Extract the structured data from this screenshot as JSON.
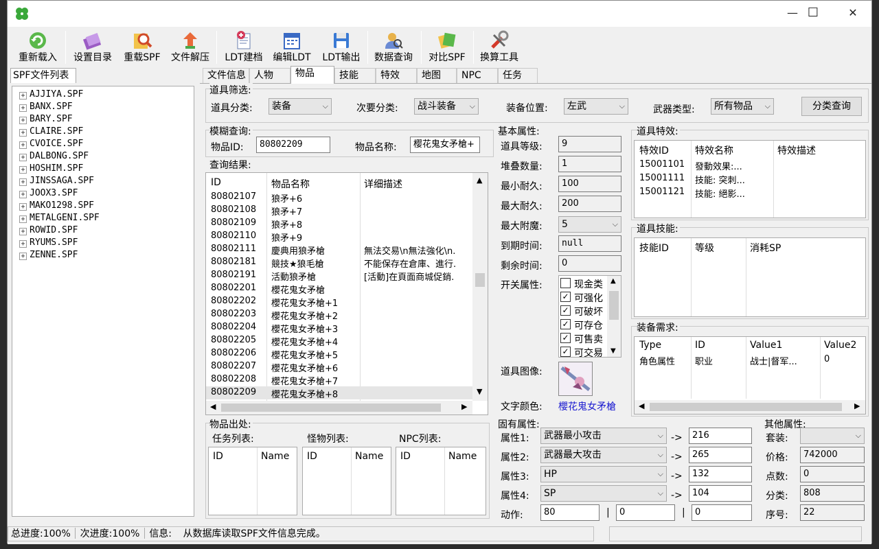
{
  "toolbar": {
    "items": [
      {
        "label": "重新载入",
        "icon": "reload-icon"
      },
      {
        "label": "设置目录",
        "icon": "folder-settings-icon"
      },
      {
        "label": "重载SPF",
        "icon": "search-reload-icon"
      },
      {
        "label": "文件解压",
        "icon": "extract-icon"
      },
      {
        "label": "LDT建档",
        "icon": "add-document-icon"
      },
      {
        "label": "编辑LDT",
        "icon": "calendar-edit-icon"
      },
      {
        "label": "LDT输出",
        "icon": "save-disk-icon"
      },
      {
        "label": "数据查询",
        "icon": "user-search-icon"
      },
      {
        "label": "对比SPF",
        "icon": "compare-icon"
      },
      {
        "label": "换算工具",
        "icon": "tools-icon"
      }
    ]
  },
  "left": {
    "title": "SPF文件列表",
    "files": [
      "AJJIYA.SPF",
      "BANX.SPF",
      "BARY.SPF",
      "CLAIRE.SPF",
      "CVOICE.SPF",
      "DALBONG.SPF",
      "HOSHIM.SPF",
      "JINSSAGA.SPF",
      "JOOX3.SPF",
      "MAKO1298.SPF",
      "METALGENI.SPF",
      "ROWID.SPF",
      "RYUMS.SPF",
      "ZENNE.SPF"
    ]
  },
  "tabs": [
    "文件信息",
    "人物",
    "物品",
    "技能",
    "特效",
    "地图",
    "NPC",
    "任务"
  ],
  "filter": {
    "title": "道具筛选:",
    "cat_label": "道具分类:",
    "cat_value": "装备",
    "sub_label": "次要分类:",
    "sub_value": "战斗装备",
    "pos_label": "装备位置:",
    "pos_value": "左武",
    "weapon_label": "武器类型:",
    "weapon_value": "所有物品",
    "query_button": "分类查询"
  },
  "fuzzy": {
    "title": "模糊查询:",
    "id_label": "物品ID:",
    "id_value": "80802209",
    "name_label": "物品名称:",
    "name_value": "樱花鬼女矛槍+"
  },
  "results": {
    "title": "查询结果:",
    "headers": [
      "ID",
      "物品名称",
      "详细描述"
    ],
    "rows": [
      [
        "80802107",
        "狼矛+6",
        ""
      ],
      [
        "80802108",
        "狼矛+7",
        ""
      ],
      [
        "80802109",
        "狼矛+8",
        ""
      ],
      [
        "80802110",
        "狼矛+9",
        ""
      ],
      [
        "80802111",
        "慶典用狼矛槍",
        "無法交易\\n無法強化\\n."
      ],
      [
        "80802181",
        "競技★狼毛槍",
        "不能保存在倉庫、進行."
      ],
      [
        "80802191",
        "活動狼矛槍",
        "[活動]在頁面商城促銷."
      ],
      [
        "80802201",
        "櫻花鬼女矛槍",
        ""
      ],
      [
        "80802202",
        "櫻花鬼女矛槍+1",
        ""
      ],
      [
        "80802203",
        "櫻花鬼女矛槍+2",
        ""
      ],
      [
        "80802204",
        "櫻花鬼女矛槍+3",
        ""
      ],
      [
        "80802205",
        "櫻花鬼女矛槍+4",
        ""
      ],
      [
        "80802206",
        "櫻花鬼女矛槍+5",
        ""
      ],
      [
        "80802207",
        "櫻花鬼女矛槍+6",
        ""
      ],
      [
        "80802208",
        "櫻花鬼女矛槍+7",
        ""
      ],
      [
        "80802209",
        "櫻花鬼女矛槍+8",
        ""
      ]
    ]
  },
  "basic": {
    "title": "基本属性:",
    "level_label": "道具等级:",
    "level": "9",
    "stack_label": "堆叠数量:",
    "stack": "1",
    "mindur_label": "最小耐久:",
    "mindur": "100",
    "maxdur_label": "最大耐久:",
    "maxdur": "200",
    "maxench_label": "最大附魔:",
    "maxench": "5",
    "expire_label": "到期时间:",
    "expire": "null",
    "remain_label": "剩余时间:",
    "remain": "0",
    "switch_label": "开关属性:",
    "switches": [
      {
        "label": "现金类",
        "checked": false
      },
      {
        "label": "可强化",
        "checked": true
      },
      {
        "label": "可破坏",
        "checked": true
      },
      {
        "label": "可存仓",
        "checked": true
      },
      {
        "label": "可售卖",
        "checked": true
      },
      {
        "label": "可交易",
        "checked": true
      }
    ],
    "image_label": "道具图像:",
    "color_label": "文字颜色:",
    "color_text": "櫻花鬼女矛槍"
  },
  "effects": {
    "title": "道具特效:",
    "headers": [
      "特效ID",
      "特效名称",
      "特效描述"
    ],
    "rows": [
      [
        "15001101",
        "發動效果:..."
      ],
      [
        "15001111",
        "技能: 突刺..."
      ],
      [
        "15001121",
        "技能: 絕影..."
      ]
    ]
  },
  "skills": {
    "title": "道具技能:",
    "headers": [
      "技能ID",
      "等级",
      "消耗SP"
    ]
  },
  "requirements": {
    "title": "装备需求:",
    "headers": [
      "Type",
      "ID",
      "Value1",
      "Value2"
    ],
    "row": [
      "角色属性",
      "职业",
      "战士|督军...",
      "0"
    ]
  },
  "source": {
    "title": "物品出处:",
    "quest_label": "任务列表:",
    "monster_label": "怪物列表:",
    "npc_label": "NPC列表:",
    "col_id": "ID",
    "col_name": "Name"
  },
  "fixed": {
    "title": "固有属性:",
    "attrs": [
      {
        "label": "属性1:",
        "name": "武器最小攻击",
        "value": "216"
      },
      {
        "label": "属性2:",
        "name": "武器最大攻击",
        "value": "265"
      },
      {
        "label": "属性3:",
        "name": "HP",
        "value": "132"
      },
      {
        "label": "属性4:",
        "name": "SP",
        "value": "104"
      }
    ],
    "arrow": "->",
    "action_label": "动作:",
    "actions": [
      "80",
      "0",
      "0"
    ],
    "bar": "|"
  },
  "other": {
    "title": "其他属性:",
    "set_label": "套装:",
    "set": "",
    "price_label": "价格:",
    "price": "742000",
    "points_label": "点数:",
    "points": "0",
    "class_label": "分类:",
    "class": "808",
    "seq_label": "序号:",
    "seq": "22"
  },
  "status": {
    "total_label": "总进度:",
    "total": "100%",
    "sub_label": "次进度:",
    "sub": "100%",
    "info_label": "信息:",
    "info": "从数据库读取SPF文件信息完成。"
  },
  "window": {
    "minimize": "—",
    "maximize": "☐",
    "close": "✕"
  }
}
